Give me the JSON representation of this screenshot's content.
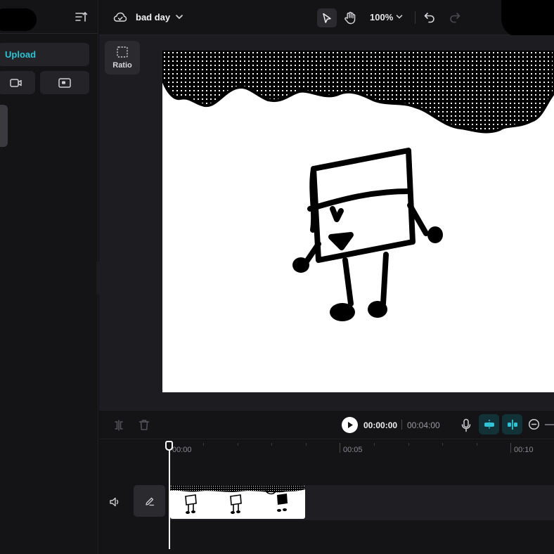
{
  "sidebar": {
    "upload_label": "Upload",
    "icons": [
      "sort-icon",
      "video-camera-icon",
      "screen-record-icon"
    ]
  },
  "topbar": {
    "project_title": "bad day",
    "zoom": "100%",
    "icons": [
      "cloud-icon",
      "chevron-down-icon",
      "cursor-select-icon",
      "hand-pan-icon",
      "undo-icon",
      "redo-icon"
    ]
  },
  "workspace": {
    "ratio_label": "Ratio"
  },
  "player": {
    "current_time": "00:00:00",
    "total_time": "00:04:00"
  },
  "timeline": {
    "ticks": [
      "00:00",
      "00:05",
      "00:10"
    ]
  },
  "colors": {
    "accent": "#2fc3d4",
    "background": "#141416",
    "panel": "#1d1d21",
    "button": "#232328"
  }
}
